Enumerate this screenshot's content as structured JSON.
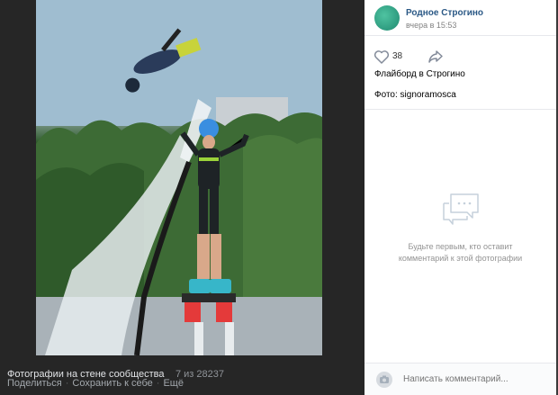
{
  "viewer": {
    "album_title": "Фотографии на стене сообщества",
    "counter": "7 из 28237",
    "actions": [
      "Поделиться",
      "Сохранить к себе",
      "Ещё"
    ]
  },
  "post": {
    "group_name": "Родное Строгино",
    "time": "вчера в 15:53",
    "likes": "38",
    "description": "Флайборд в Строгино",
    "credit": "Фото: signoramosca"
  },
  "comments": {
    "empty_text": "Будьте первым, кто оставит комментарий к этой фотографии",
    "input_placeholder": "Написать комментарий..."
  },
  "icons": {
    "like": "heart-icon",
    "share": "share-arrow-icon",
    "empty": "chat-bubbles-icon",
    "camera": "camera-icon"
  },
  "colors": {
    "link": "#2a5885",
    "muted": "#828282",
    "dark_bg": "#262626"
  }
}
